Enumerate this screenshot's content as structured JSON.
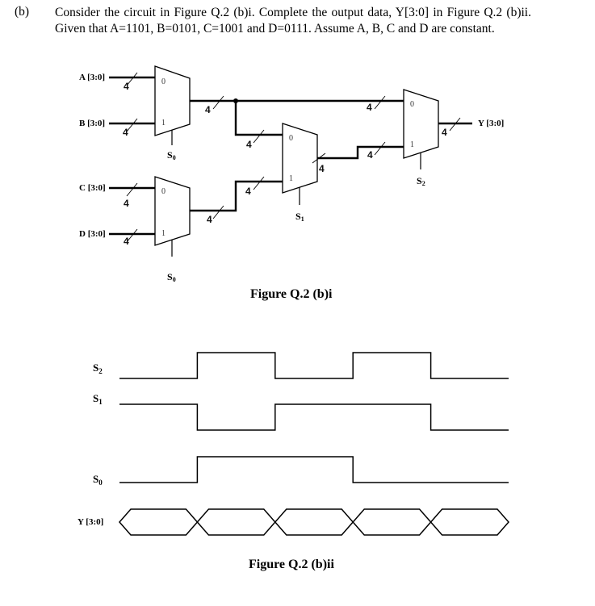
{
  "question": {
    "label": "(b)",
    "text": "Consider the circuit in Figure Q.2 (b)i. Complete the output data, Y[3:0] in Figure Q.2 (b)ii. Given that A=1101, B=0101, C=1001 and D=0111. Assume A, B, C and D are constant."
  },
  "circuit": {
    "caption": "Figure Q.2 (b)i",
    "inputs": [
      {
        "name": "A [3:0]",
        "value": "1101"
      },
      {
        "name": "B [3:0]",
        "value": "0101"
      },
      {
        "name": "C [3:0]",
        "value": "1001"
      },
      {
        "name": "D [3:0]",
        "value": "0111"
      }
    ],
    "output": "Y [3:0]",
    "bus_width": "4",
    "port0": "0",
    "port1": "1",
    "selects": {
      "s0": "S",
      "s0_sub": "0",
      "s1": "S",
      "s1_sub": "1",
      "s2": "S",
      "s2_sub": "2"
    },
    "muxes": [
      {
        "name": "mux-ab",
        "in0": "A [3:0]",
        "in1": "B [3:0]",
        "select": "S0"
      },
      {
        "name": "mux-cd",
        "in0": "C [3:0]",
        "in1": "D [3:0]",
        "select": "S0"
      },
      {
        "name": "mux-s1",
        "in0": "mux-ab output",
        "in1": "mux-cd output",
        "select": "S1"
      },
      {
        "name": "mux-s2",
        "in0": "mux-ab output",
        "in1": "mux-s1 output",
        "select": "S2"
      }
    ]
  },
  "timing": {
    "caption": "Figure Q.2 (b)ii",
    "labels": {
      "s2": "S",
      "s2_sub": "2",
      "s1": "S",
      "s1_sub": "1",
      "s0": "S",
      "s0_sub": "0",
      "y": "Y [3:0]"
    },
    "periods": 5,
    "s2": [
      0,
      1,
      0,
      1,
      0
    ],
    "s1": [
      1,
      0,
      1,
      1,
      0
    ],
    "s0": [
      0,
      1,
      1,
      0,
      0
    ],
    "y": [
      "",
      "",
      "",
      "",
      ""
    ]
  }
}
